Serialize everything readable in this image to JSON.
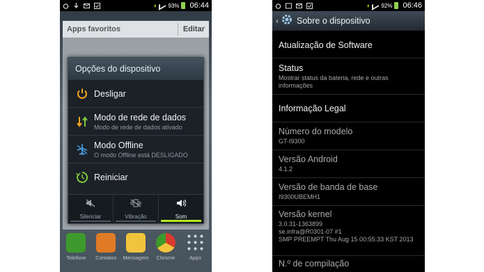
{
  "left_screen": {
    "status_bar": {
      "battery": "93%",
      "time": "06:44"
    },
    "favorites_header": {
      "title": "Apps favoritos",
      "edit": "Editar"
    },
    "dialog": {
      "title": "Opções do dispositivo",
      "options": [
        {
          "label": "Desligar",
          "sublabel": "",
          "icon": "power-icon"
        },
        {
          "label": "Modo de rede de dados",
          "sublabel": "Modo de rede de dados ativado",
          "icon": "data-arrows-icon"
        },
        {
          "label": "Modo Offline",
          "sublabel": "O modo Offline está DESLIGADO",
          "icon": "airplane-icon"
        },
        {
          "label": "Reiniciar",
          "sublabel": "",
          "icon": "restart-icon"
        }
      ],
      "sound_modes": [
        {
          "label": "Silenciar",
          "icon": "mute-icon",
          "active": false
        },
        {
          "label": "Vibração",
          "icon": "vibrate-icon",
          "active": false
        },
        {
          "label": "Som",
          "icon": "speaker-icon",
          "active": true
        }
      ]
    },
    "dock": [
      {
        "label": "Telefone",
        "icon": "phone-icon",
        "color": "#3e9a2c"
      },
      {
        "label": "Contatos",
        "icon": "contacts-icon",
        "color": "#e07a25"
      },
      {
        "label": "Mensagem",
        "icon": "message-icon",
        "color": "#f2c33c"
      },
      {
        "label": "Chrome",
        "icon": "chrome-icon",
        "color": "#d83a2e"
      },
      {
        "label": "Apps",
        "icon": "apps-grid-icon",
        "color": "#7b858d"
      }
    ]
  },
  "right_screen": {
    "status_bar": {
      "battery": "92%",
      "time": "06:46"
    },
    "action_bar": {
      "title": "Sobre o dispositivo"
    },
    "items": [
      {
        "title": "Atualização de Software",
        "subtitle": ""
      },
      {
        "title": "Status",
        "subtitle": "Mostrar status da bateria, rede e outras informações"
      },
      {
        "title": "Informação Legal",
        "subtitle": ""
      },
      {
        "title": "Número do modelo",
        "subtitle": "GT-I9300"
      },
      {
        "title": "Versão Android",
        "subtitle": "4.1.2"
      },
      {
        "title": "Versão de banda de base",
        "subtitle": "I9300UBEMH1"
      },
      {
        "title": "Versão kernel",
        "subtitle": "3.0.31-1363899\nse.infra@R0301-07 #1\nSMP PREEMPT Thu Aug 15 00:55:33 KST 2013"
      },
      {
        "title": "N.º de compilação",
        "subtitle": ""
      }
    ]
  }
}
